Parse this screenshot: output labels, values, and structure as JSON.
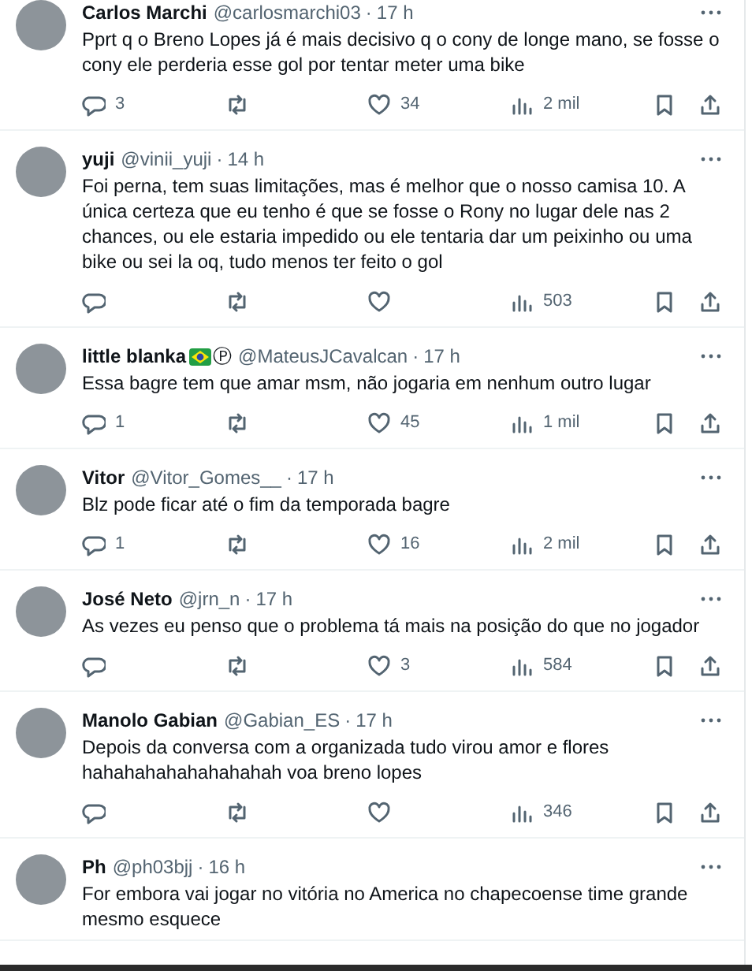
{
  "replies": [
    {
      "name": "Carlos Marchi",
      "handle": "@carlosmarchi03",
      "separator": "·",
      "time": "17 h",
      "text": "Pprt q o Breno Lopes já é mais decisivo q o cony de longe mano, se fosse o cony ele perderia esse gol por tentar meter uma bike",
      "actions": {
        "replies": "3",
        "likes": "34",
        "views": "2 mil"
      }
    },
    {
      "name": "yuji",
      "handle": "@vinii_yuji",
      "separator": "·",
      "time": "14 h",
      "text": "Foi perna, tem suas limitações, mas é melhor que o nosso camisa 10. A única certeza que eu tenho é que se fosse o Rony no lugar dele nas 2 chances, ou ele estaria impedido ou ele tentaria dar um peixinho ou uma bike ou sei la oq, tudo menos ter feito o gol",
      "actions": {
        "views": "503"
      }
    },
    {
      "name": "little blanka",
      "flag_icon": true,
      "name_suffix": "Ⓟ",
      "handle": "@MateusJCavalcan",
      "separator": "·",
      "time": "17 h",
      "text": "Essa bagre tem que amar msm, não jogaria em nenhum outro lugar",
      "actions": {
        "replies": "1",
        "likes": "45",
        "views": "1 mil"
      }
    },
    {
      "name": "Vitor",
      "handle": "@Vitor_Gomes__",
      "separator": "·",
      "time": "17 h",
      "text": "Blz pode ficar até o fim da temporada bagre",
      "actions": {
        "replies": "1",
        "likes": "16",
        "views": "2 mil"
      }
    },
    {
      "name": "José Neto",
      "handle": "@jrn_n",
      "separator": "·",
      "time": "17 h",
      "text": "As vezes eu penso que o problema tá mais na posição do que no jogador",
      "actions": {
        "likes": "3",
        "views": "584"
      }
    },
    {
      "name": "Manolo Gabian",
      "handle": "@Gabian_ES",
      "separator": "·",
      "time": "17 h",
      "text": "Depois da conversa com a organizada tudo virou amor e flores hahahahahahahahahah voa breno lopes",
      "actions": {
        "views": "346"
      }
    },
    {
      "name": "Ph",
      "handle": "@ph03bjj",
      "separator": "·",
      "time": "16 h",
      "text": "For embora vai jogar no vitória no America no chapecoense time grande mesmo esquece"
    }
  ]
}
